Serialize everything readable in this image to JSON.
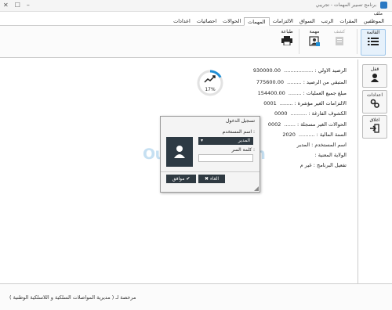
{
  "window": {
    "title": "برنامج تسيير المهمات - تجريبي"
  },
  "menu": {
    "file_label": "ملف"
  },
  "tabs": [
    {
      "label": "الموظفين",
      "active": false
    },
    {
      "label": "المقرات",
      "active": false
    },
    {
      "label": "الرتب",
      "active": false
    },
    {
      "label": "السواق",
      "active": false
    },
    {
      "label": "الالتزامات",
      "active": false
    },
    {
      "label": "المهمات",
      "active": true
    },
    {
      "label": "الحوالات",
      "active": false
    },
    {
      "label": "احصائيات",
      "active": false
    },
    {
      "label": "اعدادات",
      "active": false
    }
  ],
  "ribbon": {
    "list_label": "القائمة",
    "mission_label": "مهمة",
    "statement_label": "كشف",
    "print_label": "طباعة"
  },
  "side": {
    "lock_label": "قفل",
    "settings_label": "اعدادات",
    "close_label": "اغلاق"
  },
  "stats": [
    {
      "label": "الرصيد الاولي : ..................",
      "value": "930000.00"
    },
    {
      "label": "المتبقي من الرصيد : .........",
      "value": "775600.00"
    },
    {
      "label": "مبلغ جميع العمليات : ........",
      "value": "154400.00"
    },
    {
      "label": "الالتزامات الغير مؤشرة : ........",
      "value": "0001"
    },
    {
      "label": "الكشوف الفارغة : ..........",
      "value": "0000"
    },
    {
      "label": "الحوالات الغير مسجلة : .......",
      "value": "0002"
    },
    {
      "label": "السنة المالية : ..........",
      "value": "2020"
    },
    {
      "label": "اسم المستخدم : المدير",
      "value": ""
    },
    {
      "label": "الولاية المعنية :",
      "value": ""
    },
    {
      "label": "تفعيل البرنامج : غير م",
      "value": ""
    }
  ],
  "gauge": {
    "percent_text": "17%",
    "fraction": 0.17
  },
  "login": {
    "title": "تسجيل الدخول",
    "username_label": "اسم المستخدم :",
    "username_value": "المدير",
    "password_label": "كلمة السر :",
    "ok_label": "موافق",
    "cancel_label": "الغاء"
  },
  "watermark": "Ouedkniss.com",
  "footer": {
    "text": "مرخصة لـ ( مديرية المواصلات السلكية و اللاسلكية الوطنية )"
  },
  "colors": {
    "accent": "#2a78c2",
    "gauge": "#1f8fd6",
    "dark_button": "#2f3a42"
  }
}
